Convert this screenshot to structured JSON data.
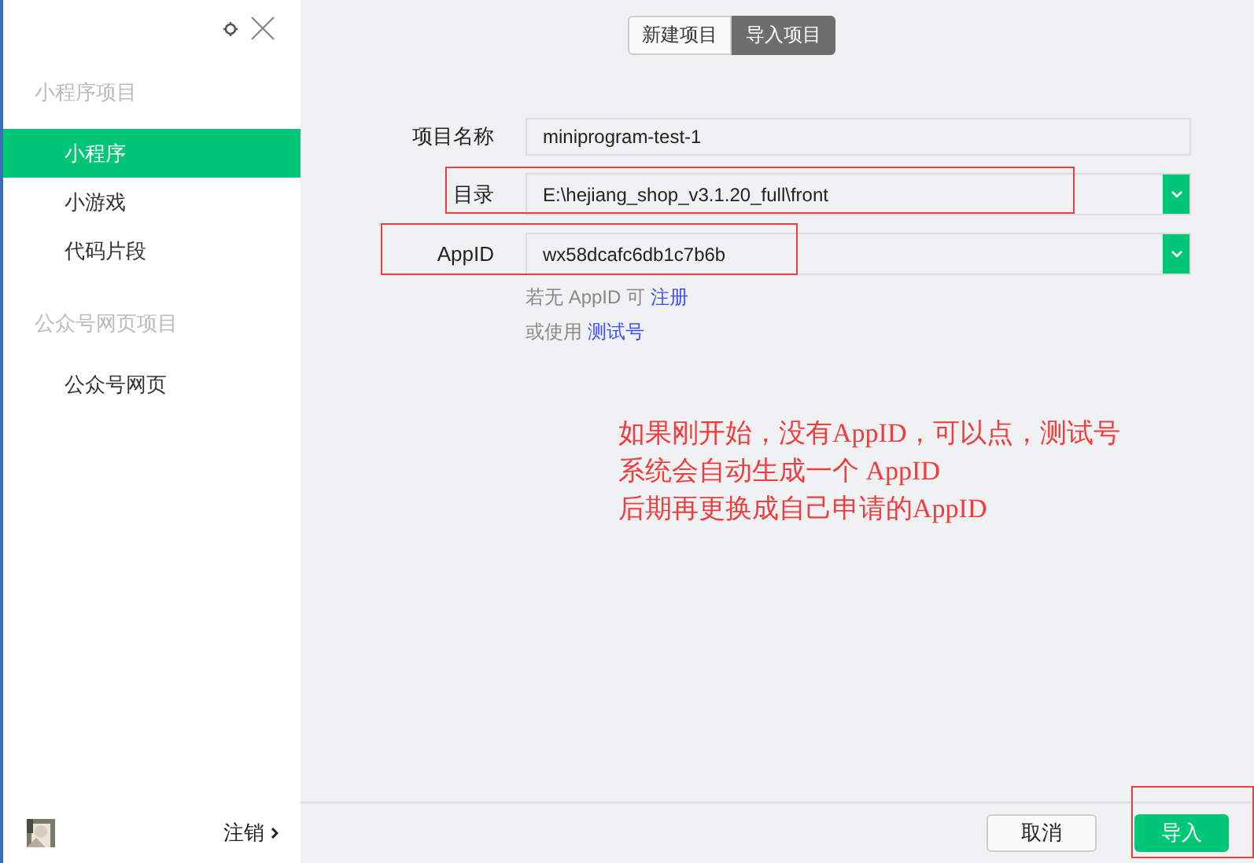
{
  "sidebar": {
    "sections": [
      {
        "title": "小程序项目",
        "items": [
          {
            "label": "小程序",
            "selected": true
          },
          {
            "label": "小游戏",
            "selected": false
          },
          {
            "label": "代码片段",
            "selected": false
          }
        ]
      },
      {
        "title": "公众号网页项目",
        "items": [
          {
            "label": "公众号网页",
            "selected": false
          }
        ]
      }
    ],
    "footer": {
      "logout": "注销"
    }
  },
  "tabs": [
    {
      "label": "新建项目",
      "selected": false
    },
    {
      "label": "导入项目",
      "selected": true
    }
  ],
  "form": {
    "fields": [
      {
        "kind": "text",
        "label": "项目名称",
        "value": "miniprogram-test-1"
      },
      {
        "kind": "select",
        "label": "目录",
        "value": "E:\\hejiang_shop_v3.1.20_full\\front",
        "highlighted": true
      },
      {
        "kind": "select",
        "label": "AppID",
        "value": "wx58dcafc6db1c7b6b",
        "highlighted": true
      }
    ],
    "hints": [
      {
        "text": "若无 AppID 可",
        "link": "注册"
      },
      {
        "text": "或使用",
        "link": "测试号"
      }
    ]
  },
  "note": [
    "如果刚开始，没有AppID，可以点，测试号",
    "系统会自动生成一个 AppID",
    "后期再更换成自己申请的AppID"
  ],
  "buttons": [
    {
      "label": "取消",
      "kind": "secondary"
    },
    {
      "label": "导入",
      "kind": "primary",
      "highlighted": true
    }
  ]
}
